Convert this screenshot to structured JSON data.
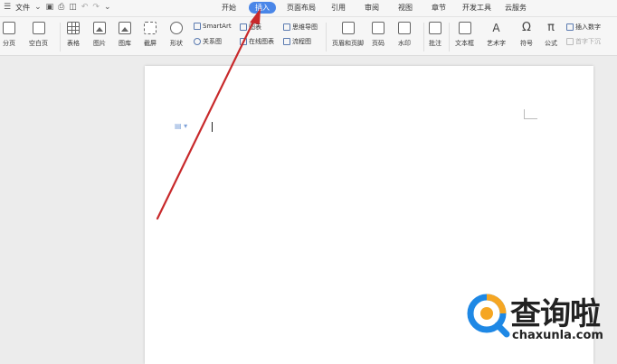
{
  "menu": {
    "file_label": "文件",
    "tabs": [
      "开始",
      "插入",
      "页面布局",
      "引用",
      "审阅",
      "视图",
      "章节",
      "开发工具",
      "云服务"
    ],
    "active_tab": "插入"
  },
  "ribbon": {
    "buttons": {
      "page_break": "分页",
      "blank_page": "空白页",
      "table": "表格",
      "picture": "图片",
      "gallery": "图库",
      "screenshot": "截屏",
      "shape": "形状",
      "header_footer": "页眉和页脚",
      "page_number": "页码",
      "watermark": "水印",
      "comment": "批注",
      "textbox": "文本框",
      "wordart": "艺术字",
      "symbol": "符号",
      "formula": "公式"
    },
    "small": {
      "smartart": "SmartArt",
      "chart": "图表",
      "relation": "关系图",
      "online_chart": "在线图表",
      "mindmap": "思维导图",
      "flowchart": "流程图",
      "insert_number": "插入数字",
      "first_sink": "首字下沉"
    }
  },
  "watermark": {
    "chinese": "查询啦",
    "url": "chaxunla.com"
  },
  "colors": {
    "active_tab": "#4a86e8",
    "arrow": "#c8292b",
    "logo_blue": "#1e88e5",
    "logo_orange": "#f5a623"
  }
}
